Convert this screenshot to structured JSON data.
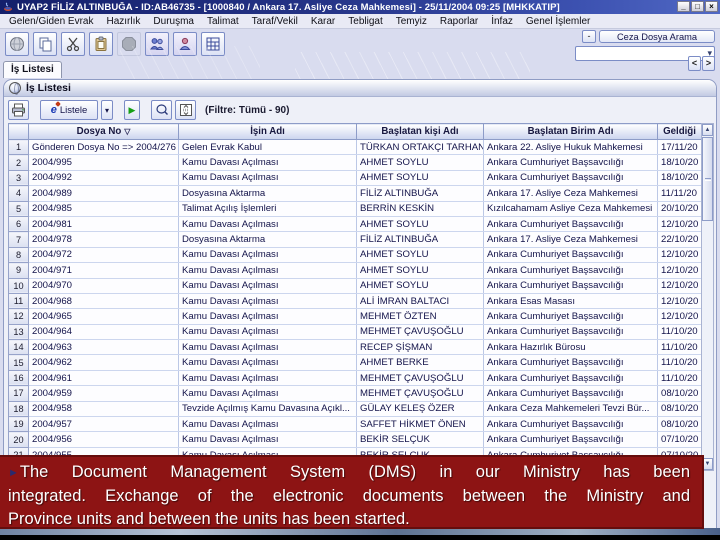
{
  "window": {
    "title": "UYAP2  FİLİZ ALTINBUĞA - ID:AB46735 - [1000840 / Ankara 17. Asliye Ceza Mahkemesi] - 25/11/2004 09:25 [MHKKATIP]",
    "controls": {
      "minimize": "_",
      "maximize": "□",
      "close": "×"
    }
  },
  "menu": {
    "items": [
      "Gelen/Giden Evrak",
      "Hazırlık",
      "Duruşma",
      "Talimat",
      "Taraf/Vekil",
      "Karar",
      "Tebligat",
      "Temyiz",
      "Raporlar",
      "İnfaz",
      "Genel İşlemler"
    ]
  },
  "toolbar": {
    "icons": [
      "globe-info-icon",
      "copy-icon",
      "cut-icon",
      "paste-icon",
      "stop-icon",
      "users-icon",
      "user-icon",
      "calculator-icon"
    ]
  },
  "search": {
    "collapse_label": "-",
    "button_label": "Ceza Dosya Arama",
    "combo_value": "",
    "combo_arrow": "▾"
  },
  "tabs": {
    "worklist": "İş Listesi",
    "nav_prev": "<",
    "nav_next": ">"
  },
  "panel": {
    "title": "İş Listesi",
    "listele_label": "Listele",
    "dropdown_arrow": "▾",
    "run_glyph": "▶",
    "filter_text": "(Filtre: Tümü - 90)"
  },
  "table": {
    "sort_icon": "▽",
    "columns": [
      "Dosya No",
      "İşin Adı",
      "Başlatan kişi Adı",
      "Başlatan Birim Adı",
      "Geldiği"
    ],
    "rows": [
      [
        "1",
        "Gönderen Dosya No => 2004/276",
        "Gelen Evrak Kabul",
        "TÜRKAN ORTAKÇI TARHAN",
        "Ankara 22. Asliye Hukuk Mahkemesi",
        "17/11/20"
      ],
      [
        "2",
        "2004/995",
        "Kamu Davası Açılması",
        "AHMET SOYLU",
        "Ankara Cumhuriyet Başsavcılığı",
        "18/10/20"
      ],
      [
        "3",
        "2004/992",
        "Kamu Davası Açılması",
        "AHMET SOYLU",
        "Ankara Cumhuriyet Başsavcılığı",
        "18/10/20"
      ],
      [
        "4",
        "2004/989",
        "Dosyasına Aktarma",
        "FİLİZ ALTINBUĞA",
        "Ankara 17. Asliye Ceza Mahkemesi",
        "11/11/20"
      ],
      [
        "5",
        "2004/985",
        "Talimat Açılış İşlemleri",
        "BERRİN KESKİN",
        "Kızılcahamam Asliye Ceza Mahkemesi",
        "20/10/20"
      ],
      [
        "6",
        "2004/981",
        "Kamu Davası Açılması",
        "AHMET SOYLU",
        "Ankara Cumhuriyet Başsavcılığı",
        "12/10/20"
      ],
      [
        "7",
        "2004/978",
        "Dosyasına Aktarma",
        "FİLİZ ALTINBUĞA",
        "Ankara 17. Asliye Ceza Mahkemesi",
        "22/10/20"
      ],
      [
        "8",
        "2004/972",
        "Kamu Davası Açılması",
        "AHMET SOYLU",
        "Ankara Cumhuriyet Başsavcılığı",
        "12/10/20"
      ],
      [
        "9",
        "2004/971",
        "Kamu Davası Açılması",
        "AHMET SOYLU",
        "Ankara Cumhuriyet Başsavcılığı",
        "12/10/20"
      ],
      [
        "10",
        "2004/970",
        "Kamu Davası Açılması",
        "AHMET SOYLU",
        "Ankara Cumhuriyet Başsavcılığı",
        "12/10/20"
      ],
      [
        "11",
        "2004/968",
        "Kamu Davası Açılması",
        "ALİ İMRAN BALTACI",
        "Ankara Esas Masası",
        "12/10/20"
      ],
      [
        "12",
        "2004/965",
        "Kamu Davası Açılması",
        "MEHMET ÖZTEN",
        "Ankara Cumhuriyet Başsavcılığı",
        "12/10/20"
      ],
      [
        "13",
        "2004/964",
        "Kamu Davası Açılması",
        "MEHMET ÇAVUŞOĞLU",
        "Ankara Cumhuriyet Başsavcılığı",
        "11/10/20"
      ],
      [
        "14",
        "2004/963",
        "Kamu Davası Açılması",
        "RECEP ŞİŞMAN",
        "Ankara Hazırlık Bürosu",
        "11/10/20"
      ],
      [
        "15",
        "2004/962",
        "Kamu Davası Açılması",
        "AHMET BERKE",
        "Ankara Cumhuriyet Başsavcılığı",
        "11/10/20"
      ],
      [
        "16",
        "2004/961",
        "Kamu Davası Açılması",
        "MEHMET ÇAVUŞOĞLU",
        "Ankara Cumhuriyet Başsavcılığı",
        "11/10/20"
      ],
      [
        "17",
        "2004/959",
        "Kamu Davası Açılması",
        "MEHMET ÇAVUŞOĞLU",
        "Ankara Cumhuriyet Başsavcılığı",
        "08/10/20"
      ],
      [
        "18",
        "2004/958",
        "Tevzide Açılmış Kamu Davasına Açıkl...",
        "GÜLAY KELEŞ ÖZER",
        "Ankara Ceza Mahkemeleri Tevzi Bür...",
        "08/10/20"
      ],
      [
        "19",
        "2004/957",
        "Kamu Davası Açılması",
        "SAFFET HİKMET ÖNEN",
        "Ankara Cumhuriyet Başsavcılığı",
        "08/10/20"
      ],
      [
        "20",
        "2004/956",
        "Kamu Davası Açılması",
        "BEKİR SELÇUK",
        "Ankara Cumhuriyet Başsavcılığı",
        "07/10/20"
      ],
      [
        "21",
        "2004/955",
        "Kamu Davası Açılması",
        "BEKİR SELÇUK",
        "Ankara Cumhuriyet Başsavcılığı",
        "07/10/20"
      ]
    ]
  },
  "overlay": {
    "bullet": "►",
    "lines": [
      "The Document Management System (DMS) in our Ministry has been",
      "integrated. Exchange of the electronic documents between the Ministry and",
      "Province units and between the units has been started."
    ]
  },
  "colors": {
    "titlebar_blue": "#253487",
    "overlay_red": "#8d1414",
    "accent_border": "#7b8cc6",
    "row_text": "#13134a",
    "run_green": "#15a015"
  }
}
